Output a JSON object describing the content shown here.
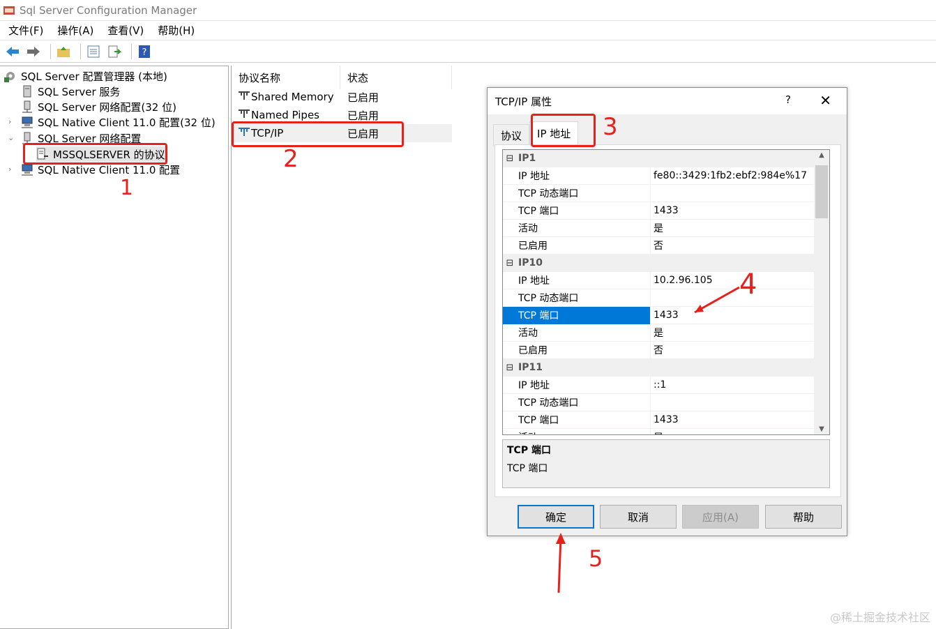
{
  "window": {
    "title": "Sql Server Configuration Manager",
    "menu": [
      "文件(F)",
      "操作(A)",
      "查看(V)",
      "帮助(H)"
    ]
  },
  "tree": {
    "root": "SQL Server 配置管理器 (本地)",
    "items": [
      "SQL Server 服务",
      "SQL Server 网络配置(32 位)",
      "SQL Native Client 11.0 配置(32 位)",
      "SQL Server 网络配置",
      "MSSQLSERVER 的协议",
      "SQL Native Client 11.0 配置"
    ]
  },
  "list": {
    "columns": [
      "协议名称",
      "状态"
    ],
    "rows": [
      {
        "name": "Shared Memory",
        "status": "已启用"
      },
      {
        "name": "Named Pipes",
        "status": "已启用"
      },
      {
        "name": "TCP/IP",
        "status": "已启用"
      }
    ]
  },
  "dialog": {
    "title": "TCP/IP 属性",
    "help": "?",
    "close": "✕",
    "tabs": [
      "协议",
      "IP 地址"
    ],
    "grid": [
      {
        "type": "cat",
        "label": "IP1"
      },
      {
        "type": "prop",
        "name": "IP 地址",
        "value": "fe80::3429:1fb2:ebf2:984e%17"
      },
      {
        "type": "prop",
        "name": "TCP 动态端口",
        "value": ""
      },
      {
        "type": "prop",
        "name": "TCP 端口",
        "value": "1433"
      },
      {
        "type": "prop",
        "name": "活动",
        "value": "是"
      },
      {
        "type": "prop",
        "name": "已启用",
        "value": "否"
      },
      {
        "type": "cat",
        "label": "IP10"
      },
      {
        "type": "prop",
        "name": "IP 地址",
        "value": "10.2.96.105"
      },
      {
        "type": "prop",
        "name": "TCP 动态端口",
        "value": ""
      },
      {
        "type": "prop",
        "name": "TCP 端口",
        "value": "1433",
        "selected": true
      },
      {
        "type": "prop",
        "name": "活动",
        "value": "是"
      },
      {
        "type": "prop",
        "name": "已启用",
        "value": "否"
      },
      {
        "type": "cat",
        "label": "IP11"
      },
      {
        "type": "prop",
        "name": "IP 地址",
        "value": "::1"
      },
      {
        "type": "prop",
        "name": "TCP 动态端口",
        "value": ""
      },
      {
        "type": "prop",
        "name": "TCP 端口",
        "value": "1433"
      },
      {
        "type": "prop",
        "name": "活动",
        "value": "是"
      }
    ],
    "description": {
      "title": "TCP 端口",
      "text": "TCP 端口"
    },
    "buttons": {
      "ok": "确定",
      "cancel": "取消",
      "apply": "应用(A)",
      "help": "帮助"
    }
  },
  "annotations": {
    "n1": "1",
    "n2": "2",
    "n3": "3",
    "n4": "4",
    "n5": "5"
  },
  "watermark": "@稀土掘金技术社区",
  "colors": {
    "highlight_red": "#e8201c",
    "selection_blue": "#0078d7"
  }
}
